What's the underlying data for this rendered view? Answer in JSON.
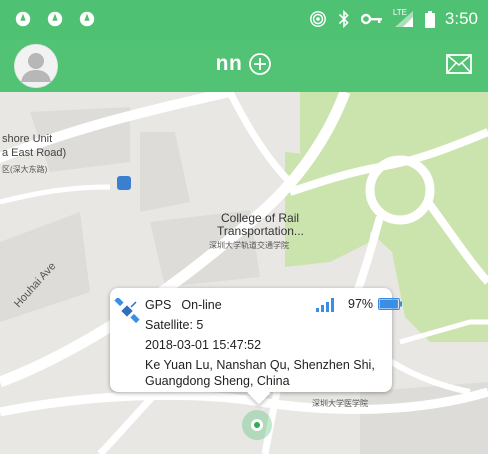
{
  "status_bar": {
    "time": "3:50",
    "network_label": "LTE",
    "icons": [
      "notification-circle-icon",
      "notification-circle-icon",
      "notification-circle-icon",
      "hotspot-icon",
      "bluetooth-icon",
      "vpn-key-icon",
      "lte-signal-icon",
      "battery-icon"
    ]
  },
  "app_bar": {
    "title": "nn",
    "add_icon": "plus-circle-icon",
    "mail_icon": "mail-icon",
    "avatar_icon": "avatar-icon",
    "color": "#52c275"
  },
  "map": {
    "labels": {
      "unit": "shore Unit",
      "east_road": "a East Road)",
      "east_road_cjk": "区(深大东路)",
      "college_line1": "College of Rail",
      "college_line2": "Transportation...",
      "college_cjk": "深圳大学轨道交通学院",
      "houhai": "Houhai Ave",
      "medical_cjk": "深圳大学医学院"
    }
  },
  "popup": {
    "gps_label": "GPS",
    "status": "On-line",
    "satellite_label": "Satellite: ",
    "satellite_count": "5",
    "datetime": "2018-03-01 15:47:52",
    "address_line1": "Ke Yuan Lu, Nanshan Qu, Shenzhen Shi,",
    "address_line2": "Guangdong Sheng, China",
    "battery_percent": "97%",
    "battery_level": 0.97,
    "signal_icon": "signal-bars-icon",
    "satellite_icon": "satellite-icon",
    "accent_color": "#3a8ee6"
  },
  "location_pin": {
    "icon": "location-pin-icon",
    "color": "#33a85a"
  }
}
